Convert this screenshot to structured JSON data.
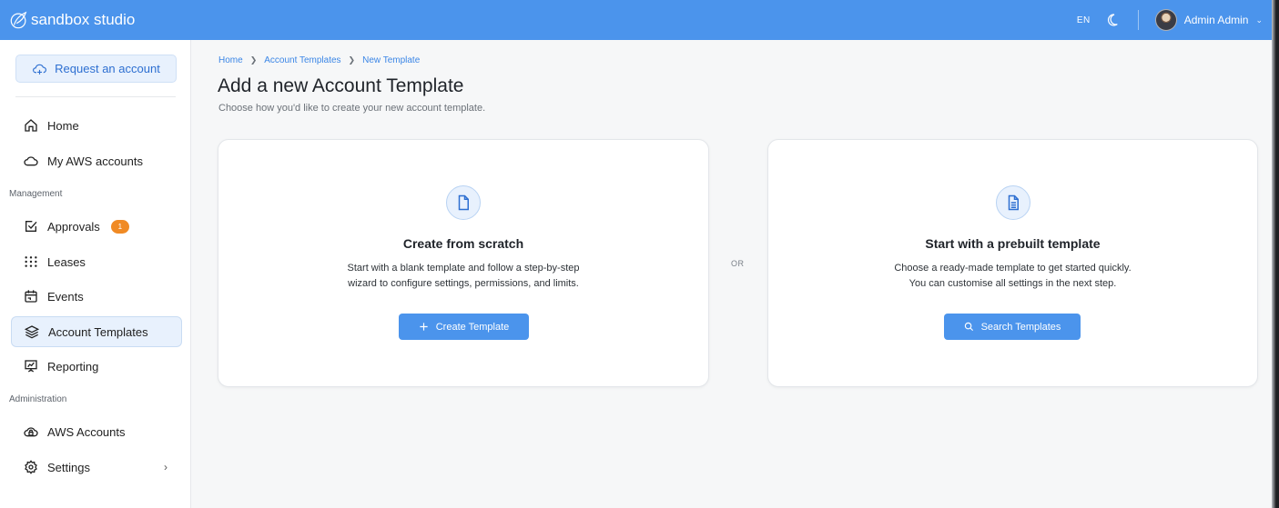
{
  "app": {
    "brand": "sandbox studio",
    "language": "EN",
    "user_name": "Admin Admin",
    "accent_color": "#4b94ec"
  },
  "sidebar": {
    "request_button": "Request an account",
    "items": [
      {
        "label": "Home",
        "icon": "home-icon"
      },
      {
        "label": "My AWS accounts",
        "icon": "cloud-icon"
      }
    ],
    "management_label": "Management",
    "management_items": [
      {
        "label": "Approvals",
        "icon": "checkbox-icon",
        "badge": "1"
      },
      {
        "label": "Leases",
        "icon": "grid-dots-icon"
      },
      {
        "label": "Events",
        "icon": "calendar-icon"
      },
      {
        "label": "Account Templates",
        "icon": "layers-icon",
        "active": true
      },
      {
        "label": "Reporting",
        "icon": "presentation-icon"
      }
    ],
    "administration_label": "Administration",
    "administration_items": [
      {
        "label": "AWS Accounts",
        "icon": "cloud-lock-icon"
      },
      {
        "label": "Settings",
        "icon": "gear-icon"
      }
    ]
  },
  "breadcrumb": [
    "Home",
    "Account Templates",
    "New Template"
  ],
  "page": {
    "title": "Add a new Account Template",
    "subtitle": "Choose how you'd like to create your new account template."
  },
  "cards": {
    "scratch": {
      "title": "Create from scratch",
      "line1": "Start with a blank template and follow a step-by-step",
      "line2": "wizard to configure settings, permissions, and limits.",
      "button": "Create Template"
    },
    "or_label": "OR",
    "prebuilt": {
      "title": "Start with a prebuilt template",
      "line1": "Choose a ready-made template to get started quickly.",
      "line2": "You can customise all settings in the next step.",
      "button": "Search Templates"
    }
  }
}
